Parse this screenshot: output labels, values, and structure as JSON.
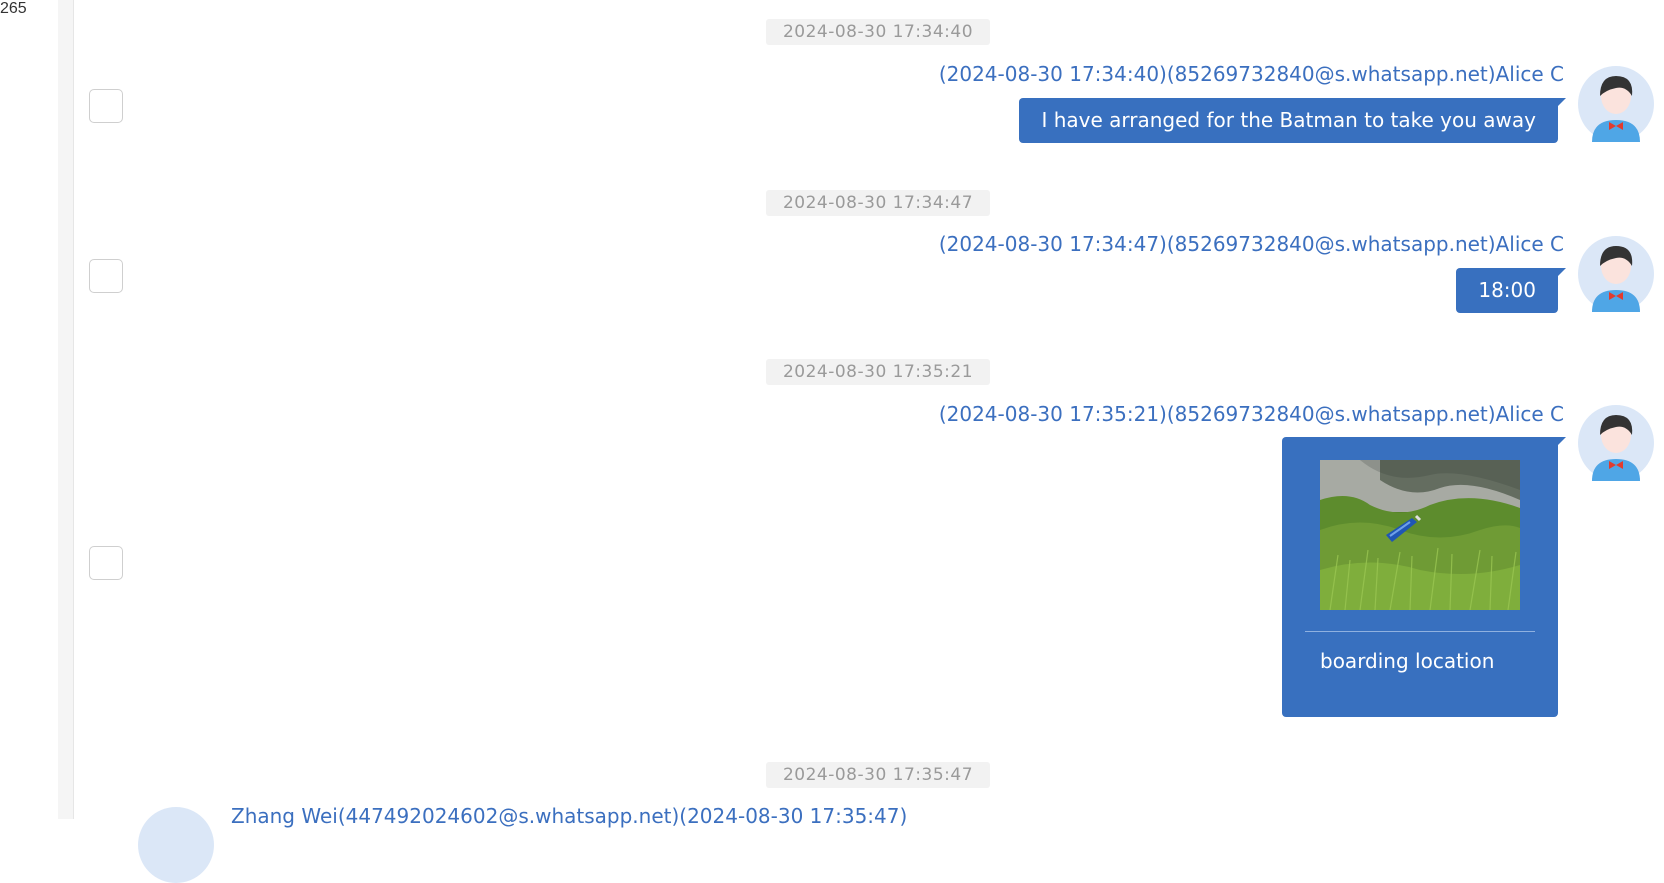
{
  "left_panel": {
    "count": "265"
  },
  "messages": [
    {
      "timestamp": "2024-08-30 17:34:40",
      "meta": "(2024-08-30 17:34:40)(85269732840@s.whatsapp.net)Alice C",
      "text": "I have arranged for the Batman to take you away"
    },
    {
      "timestamp": "2024-08-30 17:34:47",
      "meta": "(2024-08-30 17:34:47)(85269732840@s.whatsapp.net)Alice C",
      "text": "18:00"
    },
    {
      "timestamp": "2024-08-30 17:35:21",
      "meta": "(2024-08-30 17:35:21)(85269732840@s.whatsapp.net)Alice C",
      "caption": "boarding location"
    },
    {
      "timestamp": "2024-08-30 17:35:47",
      "meta": "Zhang Wei(447492024602@s.whatsapp.net)(2024-08-30 17:35:47)"
    }
  ],
  "colors": {
    "bubble": "#3870bf",
    "meta_text": "#3b6fbf",
    "timestamp_bg": "#f2f2f2",
    "timestamp_text": "#9a9a9a"
  }
}
